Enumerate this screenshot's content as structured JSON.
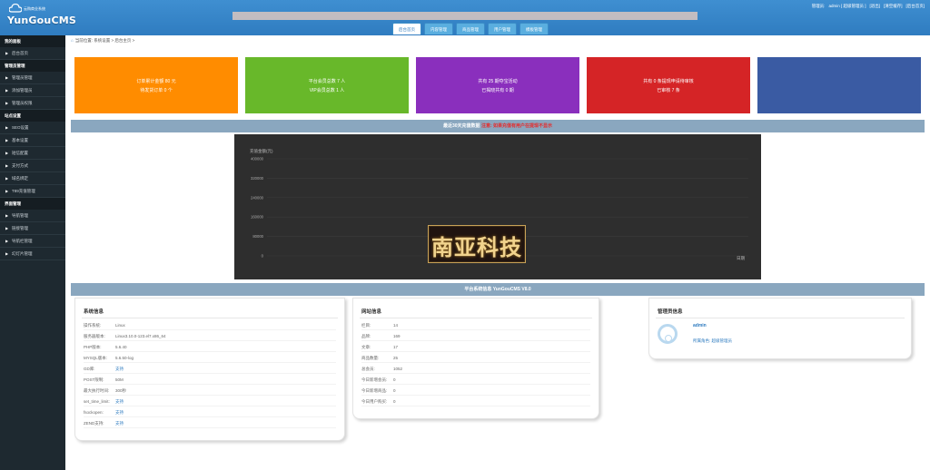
{
  "header": {
    "brand": "YunGouCMS",
    "tagline": "云购商业系统",
    "right_links": [
      "管理员:",
      "admin [ 超级管理员 ]",
      "[退出]",
      "[清空缓存]",
      "[后台首页]"
    ],
    "tabs": [
      {
        "label": "后台首页",
        "active": true
      },
      {
        "label": "内容管理",
        "active": false
      },
      {
        "label": "商品管理",
        "active": false
      },
      {
        "label": "用户管理",
        "active": false
      },
      {
        "label": "模板管理",
        "active": false
      }
    ]
  },
  "sidebar": {
    "groups": [
      {
        "title": "我的面板",
        "items": [
          "后台首页"
        ]
      },
      {
        "title": "管理员管理",
        "items": [
          "管理员管理",
          "添加管理员",
          "管理员权限"
        ]
      },
      {
        "title": "站点设置",
        "items": [
          "SEO设置",
          "基本设置",
          "短信配置",
          "支付方式",
          "域名绑定",
          "T89充值管理"
        ]
      },
      {
        "title": "界面管理",
        "items": [
          "导航管理",
          "链接管理",
          "导航栏管理",
          "幻灯片管理"
        ]
      }
    ]
  },
  "breadcrumb": "当前位置: 系统设置 > 后台主页 >",
  "cards": [
    {
      "line1": "订单累计金额 80 元",
      "line2": "待发货订单 0 个",
      "color": "#ff8c00"
    },
    {
      "line1": "平台会员总数 7 人",
      "line2": "VIP会员总数 1 人",
      "color": "#68b82a"
    },
    {
      "line1": "共有 25 期夺宝活动",
      "line2": "已揭晓共有 0 期",
      "color": "#8a2fbd"
    },
    {
      "line1": "共有 0 条提现申请待审核",
      "line2": "已审核 7 条",
      "color": "#d52426"
    },
    {
      "line1": "",
      "line2": "",
      "color": "#3a5ba3"
    }
  ],
  "chart_section": {
    "title": "最近30天充值数据",
    "warning": "注意: 如果充值有用户在提现不显示"
  },
  "chart_data": {
    "type": "line",
    "ylabel": "充值金额(元)",
    "yticks": [
      400000,
      320000,
      240000,
      160000,
      80000,
      0
    ],
    "ylim": [
      0,
      400000
    ],
    "xlabel": "日期",
    "series": []
  },
  "watermark": "南亚科技",
  "platform_bar": "平台系统信息 YunGouCMS V8.0",
  "system_info": {
    "title": "系统信息",
    "rows": [
      {
        "k": "操作系统:",
        "v": "Linux",
        "link": false
      },
      {
        "k": "服务器版本:",
        "v": "Linux3.10.0-123.el7.x86_64",
        "link": false
      },
      {
        "k": "PHP版本:",
        "v": "5.6.40",
        "link": false
      },
      {
        "k": "MYSQL版本:",
        "v": "5.6.50-log",
        "link": false
      },
      {
        "k": "GD库:",
        "v": "支持",
        "link": true
      },
      {
        "k": "POST限制:",
        "v": "50M",
        "link": false
      },
      {
        "k": "最大执行时间:",
        "v": "300秒",
        "link": false
      },
      {
        "k": "set_time_limit:",
        "v": "支持",
        "link": true
      },
      {
        "k": "fsockopen:",
        "v": "支持",
        "link": true
      },
      {
        "k": "ZEND支持:",
        "v": "支持",
        "link": true
      }
    ]
  },
  "site_info": {
    "title": "网站信息",
    "rows": [
      {
        "k": "栏目:",
        "v": "14"
      },
      {
        "k": "品牌:",
        "v": "169"
      },
      {
        "k": "文章:",
        "v": "17"
      },
      {
        "k": "商品数量:",
        "v": "25"
      },
      {
        "k": "总会员:",
        "v": "1052"
      },
      {
        "k": "今日新增会员:",
        "v": "0"
      },
      {
        "k": "今日新增商品:",
        "v": "0"
      },
      {
        "k": "今日用户购买:",
        "v": "0"
      }
    ]
  },
  "admin_info": {
    "title": "管理员信息",
    "name": "admin",
    "role_label": "所属角色:",
    "role_value": "超级管理员"
  }
}
